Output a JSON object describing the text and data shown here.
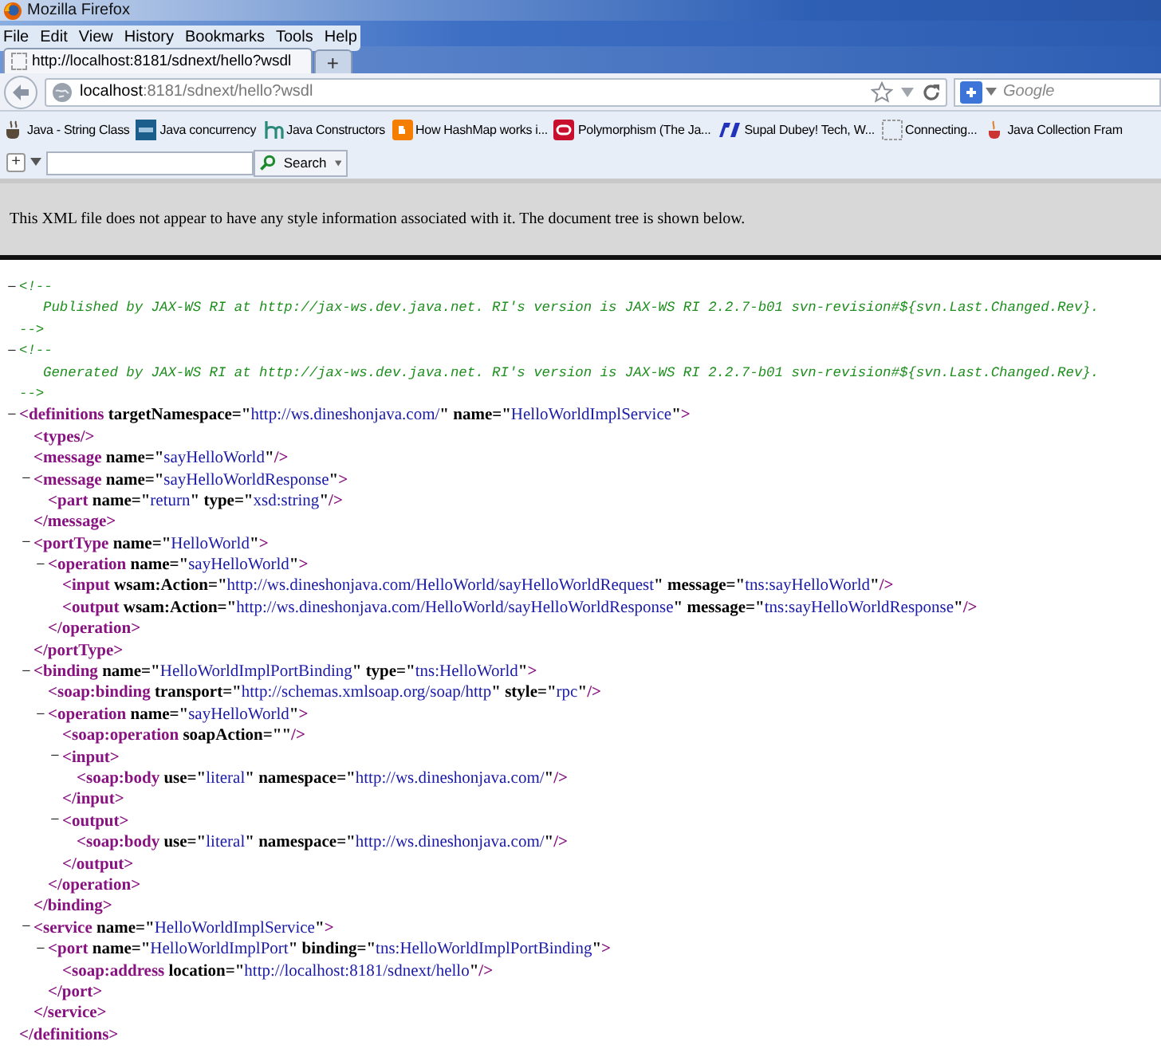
{
  "window": {
    "title": "Mozilla Firefox"
  },
  "menu": [
    "File",
    "Edit",
    "View",
    "History",
    "Bookmarks",
    "Tools",
    "Help"
  ],
  "tabs": [
    {
      "label": "http://localhost:8181/sdnext/hello?wsdl",
      "selected": true
    }
  ],
  "new_tab": "+",
  "address": {
    "host": "localhost",
    "path": ":8181/sdnext/hello?wsdl"
  },
  "search": {
    "placeholder": "Google"
  },
  "bookmarks": [
    "Java - String Class",
    "Java concurrency",
    "Java Constructors",
    "How HashMap works i...",
    "Polymorphism (The Ja...",
    "Supal Dubey! Tech, W...",
    "Connecting...",
    "Java Collection Fram"
  ],
  "toolbar": {
    "add": "+",
    "search_button": "Search"
  },
  "info": "This XML file does not appear to have any style information associated with it. The document tree is shown below.",
  "tree": [
    {
      "kind": "comment",
      "toggle": "−",
      "open": "<!--",
      "text": "Published by JAX-WS RI at http://jax-ws.dev.java.net. RI's version is JAX-WS RI 2.2.7-b01  svn-revision#${svn.Last.Changed.Rev}.",
      "close": "-->"
    },
    {
      "kind": "comment",
      "toggle": "−",
      "open": "<!--",
      "text": "Generated by JAX-WS RI at http://jax-ws.dev.java.net. RI's version is JAX-WS RI 2.2.7-b01  svn-revision#${svn.Last.Changed.Rev}.",
      "close": "-->"
    },
    {
      "kind": "element",
      "toggle": "−",
      "open": [
        {
          "kind": "tag",
          "text": "<definitions"
        },
        {
          "kind": "attr",
          "text": " targetNamespace=\""
        },
        {
          "kind": "value",
          "text": "http://ws.dineshonjava.com/"
        },
        {
          "kind": "attr",
          "text": "\" name=\""
        },
        {
          "kind": "value",
          "text": "HelloWorldImplService"
        },
        {
          "kind": "attr",
          "text": "\""
        },
        {
          "kind": "tag",
          "text": ">"
        }
      ],
      "close": [
        {
          "kind": "tag",
          "text": "</definitions>"
        }
      ],
      "children": [
        {
          "kind": "leaf",
          "line": [
            {
              "kind": "tag",
              "text": "<types/>"
            }
          ]
        },
        {
          "kind": "leaf",
          "line": [
            {
              "kind": "tag",
              "text": "<message"
            },
            {
              "kind": "attr",
              "text": " name=\""
            },
            {
              "kind": "value",
              "text": "sayHelloWorld"
            },
            {
              "kind": "attr",
              "text": "\""
            },
            {
              "kind": "tag",
              "text": "/>"
            }
          ]
        },
        {
          "kind": "element",
          "toggle": "−",
          "open": [
            {
              "kind": "tag",
              "text": "<message"
            },
            {
              "kind": "attr",
              "text": " name=\""
            },
            {
              "kind": "value",
              "text": "sayHelloWorldResponse"
            },
            {
              "kind": "attr",
              "text": "\""
            },
            {
              "kind": "tag",
              "text": ">"
            }
          ],
          "close": [
            {
              "kind": "tag",
              "text": "</message>"
            }
          ],
          "children": [
            {
              "kind": "leaf",
              "line": [
                {
                  "kind": "tag",
                  "text": "<part"
                },
                {
                  "kind": "attr",
                  "text": " name=\""
                },
                {
                  "kind": "value",
                  "text": "return"
                },
                {
                  "kind": "attr",
                  "text": "\" type=\""
                },
                {
                  "kind": "value",
                  "text": "xsd:string"
                },
                {
                  "kind": "attr",
                  "text": "\""
                },
                {
                  "kind": "tag",
                  "text": "/>"
                }
              ]
            }
          ]
        },
        {
          "kind": "element",
          "toggle": "−",
          "open": [
            {
              "kind": "tag",
              "text": "<portType"
            },
            {
              "kind": "attr",
              "text": " name=\""
            },
            {
              "kind": "value",
              "text": "HelloWorld"
            },
            {
              "kind": "attr",
              "text": "\""
            },
            {
              "kind": "tag",
              "text": ">"
            }
          ],
          "close": [
            {
              "kind": "tag",
              "text": "</portType>"
            }
          ],
          "children": [
            {
              "kind": "element",
              "toggle": "−",
              "open": [
                {
                  "kind": "tag",
                  "text": "<operation"
                },
                {
                  "kind": "attr",
                  "text": " name=\""
                },
                {
                  "kind": "value",
                  "text": "sayHelloWorld"
                },
                {
                  "kind": "attr",
                  "text": "\""
                },
                {
                  "kind": "tag",
                  "text": ">"
                }
              ],
              "close": [
                {
                  "kind": "tag",
                  "text": "</operation>"
                }
              ],
              "children": [
                {
                  "kind": "leaf",
                  "line": [
                    {
                      "kind": "tag",
                      "text": "<input"
                    },
                    {
                      "kind": "attr",
                      "text": " wsam:Action=\""
                    },
                    {
                      "kind": "value",
                      "text": "http://ws.dineshonjava.com/HelloWorld/sayHelloWorldRequest"
                    },
                    {
                      "kind": "attr",
                      "text": "\" message=\""
                    },
                    {
                      "kind": "value",
                      "text": "tns:sayHelloWorld"
                    },
                    {
                      "kind": "attr",
                      "text": "\""
                    },
                    {
                      "kind": "tag",
                      "text": "/>"
                    }
                  ]
                },
                {
                  "kind": "leaf",
                  "line": [
                    {
                      "kind": "tag",
                      "text": "<output"
                    },
                    {
                      "kind": "attr",
                      "text": " wsam:Action=\""
                    },
                    {
                      "kind": "value",
                      "text": "http://ws.dineshonjava.com/HelloWorld/sayHelloWorldResponse"
                    },
                    {
                      "kind": "attr",
                      "text": "\" message=\""
                    },
                    {
                      "kind": "value",
                      "text": "tns:sayHelloWorldResponse"
                    },
                    {
                      "kind": "attr",
                      "text": "\""
                    },
                    {
                      "kind": "tag",
                      "text": "/>"
                    }
                  ]
                }
              ]
            }
          ]
        },
        {
          "kind": "element",
          "toggle": "−",
          "open": [
            {
              "kind": "tag",
              "text": "<binding"
            },
            {
              "kind": "attr",
              "text": " name=\""
            },
            {
              "kind": "value",
              "text": "HelloWorldImplPortBinding"
            },
            {
              "kind": "attr",
              "text": "\" type=\""
            },
            {
              "kind": "value",
              "text": "tns:HelloWorld"
            },
            {
              "kind": "attr",
              "text": "\""
            },
            {
              "kind": "tag",
              "text": ">"
            }
          ],
          "close": [
            {
              "kind": "tag",
              "text": "</binding>"
            }
          ],
          "children": [
            {
              "kind": "leaf",
              "line": [
                {
                  "kind": "tag",
                  "text": "<soap:binding"
                },
                {
                  "kind": "attr",
                  "text": " transport=\""
                },
                {
                  "kind": "value",
                  "text": "http://schemas.xmlsoap.org/soap/http"
                },
                {
                  "kind": "attr",
                  "text": "\" style=\""
                },
                {
                  "kind": "value",
                  "text": "rpc"
                },
                {
                  "kind": "attr",
                  "text": "\""
                },
                {
                  "kind": "tag",
                  "text": "/>"
                }
              ]
            },
            {
              "kind": "element",
              "toggle": "−",
              "open": [
                {
                  "kind": "tag",
                  "text": "<operation"
                },
                {
                  "kind": "attr",
                  "text": " name=\""
                },
                {
                  "kind": "value",
                  "text": "sayHelloWorld"
                },
                {
                  "kind": "attr",
                  "text": "\""
                },
                {
                  "kind": "tag",
                  "text": ">"
                }
              ],
              "close": [
                {
                  "kind": "tag",
                  "text": "</operation>"
                }
              ],
              "children": [
                {
                  "kind": "leaf",
                  "line": [
                    {
                      "kind": "tag",
                      "text": "<soap:operation"
                    },
                    {
                      "kind": "attr",
                      "text": " soapAction=\"\""
                    },
                    {
                      "kind": "tag",
                      "text": "/>"
                    }
                  ]
                },
                {
                  "kind": "element",
                  "toggle": "−",
                  "open": [
                    {
                      "kind": "tag",
                      "text": "<input>"
                    }
                  ],
                  "close": [
                    {
                      "kind": "tag",
                      "text": "</input>"
                    }
                  ],
                  "children": [
                    {
                      "kind": "leaf",
                      "line": [
                        {
                          "kind": "tag",
                          "text": "<soap:body"
                        },
                        {
                          "kind": "attr",
                          "text": " use=\""
                        },
                        {
                          "kind": "value",
                          "text": "literal"
                        },
                        {
                          "kind": "attr",
                          "text": "\" namespace=\""
                        },
                        {
                          "kind": "value",
                          "text": "http://ws.dineshonjava.com/"
                        },
                        {
                          "kind": "attr",
                          "text": "\""
                        },
                        {
                          "kind": "tag",
                          "text": "/>"
                        }
                      ]
                    }
                  ]
                },
                {
                  "kind": "element",
                  "toggle": "−",
                  "open": [
                    {
                      "kind": "tag",
                      "text": "<output>"
                    }
                  ],
                  "close": [
                    {
                      "kind": "tag",
                      "text": "</output>"
                    }
                  ],
                  "children": [
                    {
                      "kind": "leaf",
                      "line": [
                        {
                          "kind": "tag",
                          "text": "<soap:body"
                        },
                        {
                          "kind": "attr",
                          "text": " use=\""
                        },
                        {
                          "kind": "value",
                          "text": "literal"
                        },
                        {
                          "kind": "attr",
                          "text": "\" namespace=\""
                        },
                        {
                          "kind": "value",
                          "text": "http://ws.dineshonjava.com/"
                        },
                        {
                          "kind": "attr",
                          "text": "\""
                        },
                        {
                          "kind": "tag",
                          "text": "/>"
                        }
                      ]
                    }
                  ]
                }
              ]
            }
          ]
        },
        {
          "kind": "element",
          "toggle": "−",
          "open": [
            {
              "kind": "tag",
              "text": "<service"
            },
            {
              "kind": "attr",
              "text": " name=\""
            },
            {
              "kind": "value",
              "text": "HelloWorldImplService"
            },
            {
              "kind": "attr",
              "text": "\""
            },
            {
              "kind": "tag",
              "text": ">"
            }
          ],
          "close": [
            {
              "kind": "tag",
              "text": "</service>"
            }
          ],
          "children": [
            {
              "kind": "element",
              "toggle": "−",
              "open": [
                {
                  "kind": "tag",
                  "text": "<port"
                },
                {
                  "kind": "attr",
                  "text": " name=\""
                },
                {
                  "kind": "value",
                  "text": "HelloWorldImplPort"
                },
                {
                  "kind": "attr",
                  "text": "\" binding=\""
                },
                {
                  "kind": "value",
                  "text": "tns:HelloWorldImplPortBinding"
                },
                {
                  "kind": "attr",
                  "text": "\""
                },
                {
                  "kind": "tag",
                  "text": ">"
                }
              ],
              "close": [
                {
                  "kind": "tag",
                  "text": "</port>"
                }
              ],
              "children": [
                {
                  "kind": "leaf",
                  "line": [
                    {
                      "kind": "tag",
                      "text": "<soap:address"
                    },
                    {
                      "kind": "attr",
                      "text": " location=\""
                    },
                    {
                      "kind": "value",
                      "text": "http://localhost:8181/sdnext/hello"
                    },
                    {
                      "kind": "attr",
                      "text": "\""
                    },
                    {
                      "kind": "tag",
                      "text": "/>"
                    }
                  ]
                }
              ]
            }
          ]
        }
      ]
    }
  ]
}
